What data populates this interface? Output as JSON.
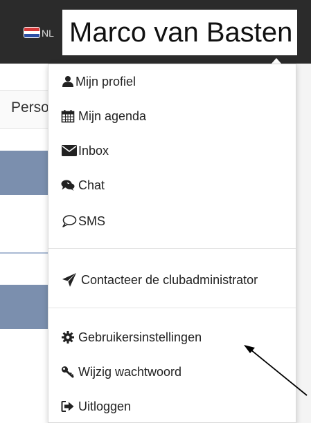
{
  "header": {
    "language": "NL",
    "user_name": "Marco van Basten"
  },
  "background": {
    "tab_label": "Personen"
  },
  "menu": {
    "profile": "Mijn profiel",
    "agenda": "Mijn agenda",
    "inbox": "Inbox",
    "chat": "Chat",
    "sms": "SMS",
    "contact_admin": "Contacteer de clubadministrator",
    "user_settings": "Gebruikersinstellingen",
    "change_password": "Wijzig wachtwoord",
    "logout": "Uitloggen"
  },
  "icons": {
    "profile": "user-icon",
    "agenda": "calendar-icon",
    "inbox": "envelope-icon",
    "chat": "comments-icon",
    "sms": "speech-bubble-icon",
    "contact_admin": "paper-plane-icon",
    "user_settings": "gear-icon",
    "change_password": "key-icon",
    "logout": "sign-out-icon"
  },
  "colors": {
    "topbar": "#2b2b2b",
    "block": "#7b8fae",
    "text": "#222222"
  }
}
